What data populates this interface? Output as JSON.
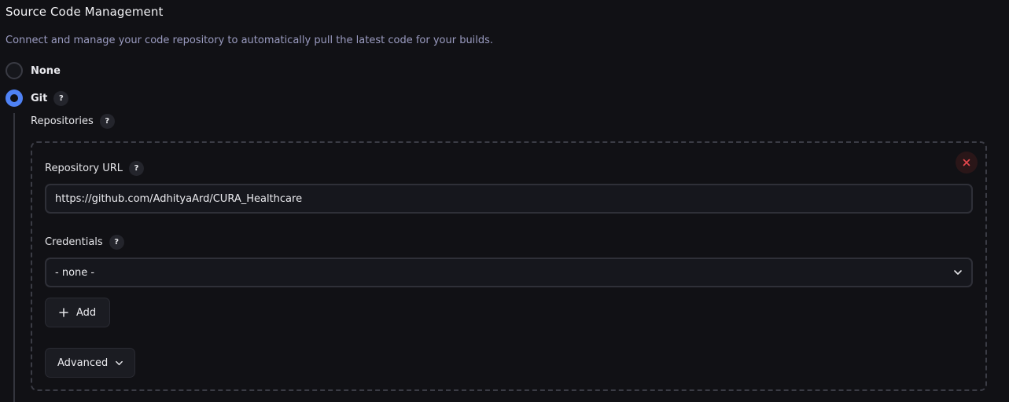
{
  "section": {
    "title": "Source Code Management",
    "description": "Connect and manage your code repository to automatically pull the latest code for your builds."
  },
  "scm_options": [
    {
      "label": "None",
      "selected": false
    },
    {
      "label": "Git",
      "selected": true
    }
  ],
  "help_glyph": "?",
  "repositories": {
    "label": "Repositories",
    "repository_url": {
      "label": "Repository URL",
      "value": "https://github.com/AdhityaArd/CURA_Healthcare"
    },
    "credentials": {
      "label": "Credentials",
      "selected": "- none -"
    },
    "add_button": "Add",
    "advanced_button": "Advanced"
  },
  "colors": {
    "accent": "#4f82f5",
    "danger": "#e5484d",
    "background": "#111115"
  },
  "icons": {
    "delete": "close-icon",
    "add": "plus-icon",
    "dropdown": "chevron-down-icon",
    "help": "help-icon"
  }
}
